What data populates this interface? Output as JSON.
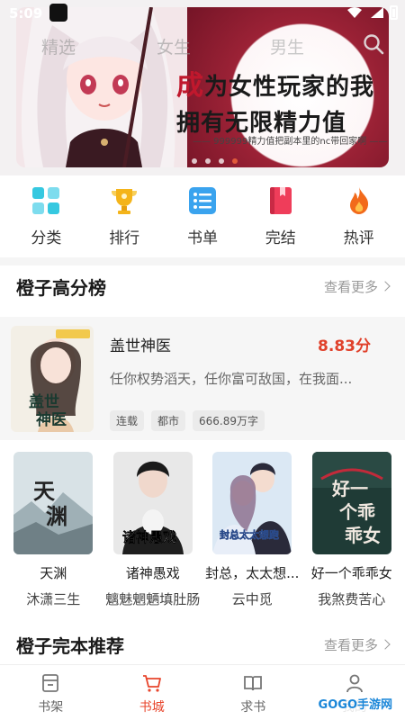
{
  "status": {
    "time": "5:09"
  },
  "top_tabs": [
    "精选",
    "女生",
    "男生"
  ],
  "banner": {
    "title_first": "成",
    "title_line1_rest": "为女性玩家的我",
    "title_line2": "拥有无限精力值",
    "subtitle": "—— 999999精力值把副本里的nc带回家啊 ——",
    "dots": 4,
    "active_dot": 3
  },
  "categories": [
    {
      "label": "分类",
      "icon": "grid-icon",
      "color": "#35c8e0"
    },
    {
      "label": "排行",
      "icon": "trophy-icon",
      "color": "#f4b41a"
    },
    {
      "label": "书单",
      "icon": "list-icon",
      "color": "#3aa3ee"
    },
    {
      "label": "完结",
      "icon": "book-icon",
      "color": "#ef3d5a"
    },
    {
      "label": "热评",
      "icon": "flame-icon",
      "color": "#f26a1b"
    }
  ],
  "section1": {
    "title": "橙子高分榜",
    "more": "查看更多"
  },
  "featured": {
    "name": "盖世神医",
    "score": "8.83分",
    "desc": "任你权势滔天，任你富可敌国，在我面...",
    "cover_text": "盖世神医",
    "tags": [
      "连载",
      "都市",
      "666.89万字"
    ]
  },
  "books": [
    {
      "title": "天渊",
      "author": "沐潇三生",
      "cover_text": "天渊"
    },
    {
      "title": "诸神愚戏",
      "author": "魑魅魍魉填肚肠",
      "cover_text": "诸神愚戏"
    },
    {
      "title": "封总，太太想...",
      "author": "云中觅",
      "cover_text": "封总，太太想..."
    },
    {
      "title": "好一个乖乖女",
      "author": "我煞费苦心",
      "cover_text": "好一个乖乖女"
    }
  ],
  "section2": {
    "title": "橙子完本推荐",
    "more": "查看更多"
  },
  "bottom_nav": [
    {
      "label": "书架",
      "icon": "bookshelf-icon"
    },
    {
      "label": "书城",
      "icon": "cart-icon",
      "active": true
    },
    {
      "label": "求书",
      "icon": "open-book-icon"
    },
    {
      "label": "我的",
      "icon": "user-icon"
    }
  ],
  "watermark": "GOGO手游网",
  "colors": {
    "accent": "#e8452c",
    "score": "#e0402a",
    "banner_maroon": "#8a1a2c"
  }
}
